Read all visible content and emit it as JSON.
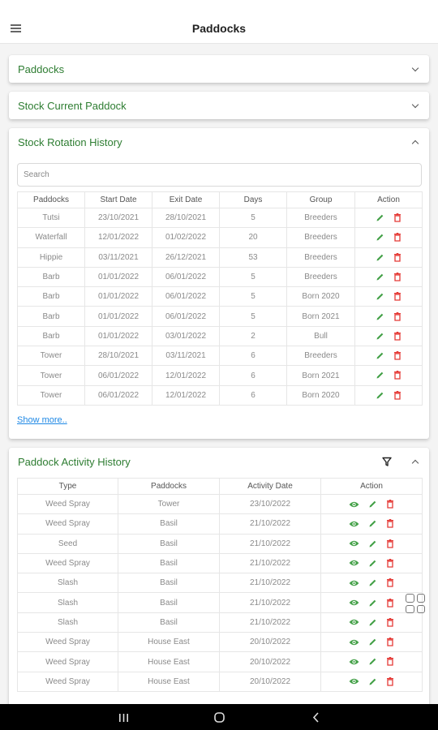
{
  "app": {
    "title": "Paddocks"
  },
  "cards": {
    "paddocks": {
      "title": "Paddocks"
    },
    "stock_current": {
      "title": "Stock Current Paddock"
    },
    "rotation": {
      "title": "Stock Rotation History",
      "search_placeholder": "Search",
      "headers": [
        "Paddocks",
        "Start Date",
        "Exit Date",
        "Days",
        "Group",
        "Action"
      ],
      "rows": [
        [
          "Tutsi",
          "23/10/2021",
          "28/10/2021",
          "5",
          "Breeders"
        ],
        [
          "Waterfall",
          "12/01/2022",
          "01/02/2022",
          "20",
          "Breeders"
        ],
        [
          "Hippie",
          "03/11/2021",
          "26/12/2021",
          "53",
          "Breeders"
        ],
        [
          "Barb",
          "01/01/2022",
          "06/01/2022",
          "5",
          "Breeders"
        ],
        [
          "Barb",
          "01/01/2022",
          "06/01/2022",
          "5",
          "Born 2020"
        ],
        [
          "Barb",
          "01/01/2022",
          "06/01/2022",
          "5",
          "Born 2021"
        ],
        [
          "Barb",
          "01/01/2022",
          "03/01/2022",
          "2",
          "Bull"
        ],
        [
          "Tower",
          "28/10/2021",
          "03/11/2021",
          "6",
          "Breeders"
        ],
        [
          "Tower",
          "06/01/2022",
          "12/01/2022",
          "6",
          "Born 2021"
        ],
        [
          "Tower",
          "06/01/2022",
          "12/01/2022",
          "6",
          "Born 2020"
        ]
      ],
      "show_more": "Show more.."
    },
    "activity": {
      "title": "Paddock Activity History",
      "headers": [
        "Type",
        "Paddocks",
        "Activity Date",
        "Action"
      ],
      "rows": [
        [
          "Weed Spray",
          "Tower",
          "23/10/2022"
        ],
        [
          "Weed Spray",
          "Basil",
          "21/10/2022"
        ],
        [
          "Seed",
          "Basil",
          "21/10/2022"
        ],
        [
          "Weed Spray",
          "Basil",
          "21/10/2022"
        ],
        [
          "Slash",
          "Basil",
          "21/10/2022"
        ],
        [
          "Slash",
          "Basil",
          "21/10/2022"
        ],
        [
          "Slash",
          "Basil",
          "21/10/2022"
        ],
        [
          "Weed Spray",
          "House East",
          "20/10/2022"
        ],
        [
          "Weed Spray",
          "House East",
          "20/10/2022"
        ],
        [
          "Weed Spray",
          "House East",
          "20/10/2022"
        ]
      ]
    }
  },
  "colors": {
    "accent_green": "#2e7d32",
    "edit_green": "#43a047",
    "delete_red": "#e53935",
    "link_blue": "#1e88e5"
  },
  "icons": [
    "menu-icon",
    "chevron-down-icon",
    "chevron-up-icon",
    "filter-icon",
    "view-icon",
    "edit-icon",
    "delete-icon",
    "grid-icon",
    "recents-icon",
    "home-icon",
    "back-icon"
  ]
}
